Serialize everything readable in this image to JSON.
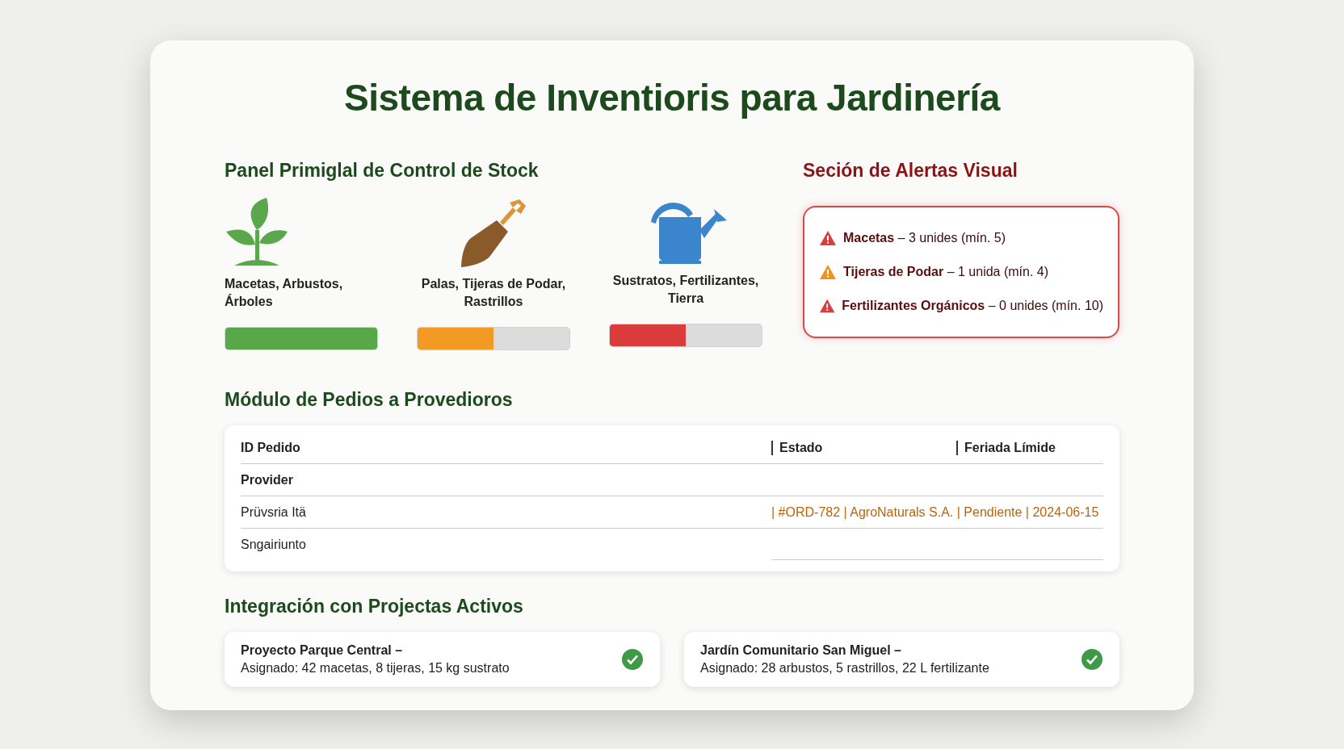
{
  "title": "Sistema de Inventioris para Jardinería",
  "stock": {
    "heading": "Panel Primiglal de Control de Stock",
    "categories": [
      {
        "kind": "plant",
        "label": "Macetas, Arbustos, Árboles",
        "level": 1,
        "color": "#58a84a"
      },
      {
        "kind": "shovel",
        "label": "Palas, Tijeras de Podar, Rastrillos",
        "level": 0.5,
        "color": "#f39a24"
      },
      {
        "kind": "watering-can",
        "label": "Sustratos, Fertilizantes, Tierra",
        "level": 0.5,
        "color": "#dc3b3b"
      }
    ]
  },
  "alerts": {
    "heading": "Seción de Alertas Visual",
    "items": [
      {
        "name": "Macetas",
        "detail": "– 3 unides (mín. 5)",
        "color": "#d64040"
      },
      {
        "name": "Tijeras de Podar",
        "detail": "– 1 unida (mín. 4)",
        "color": "#f0921f"
      },
      {
        "name": "Fertilizantes Orgánicos",
        "detail": "– 0 unides (mín. 10)",
        "color": "#d64040"
      }
    ]
  },
  "orders": {
    "heading": "Módulo de Pedios a Provedioros",
    "columns": [
      "ID Pedido",
      "Estado",
      "Feriada Límide"
    ],
    "rows": [
      {
        "kind": "label",
        "cells": [
          "Provider"
        ]
      },
      {
        "kind": "order",
        "cells": [
          "Prüvsria Itä",
          "| #ORD-782 | AgroNaturals S.A.  | Pendiente | 2024-06-15"
        ]
      },
      {
        "kind": "plain",
        "cells": [
          "Sngairiunto"
        ]
      }
    ]
  },
  "projects": {
    "heading": "Integración con Projectas Activos",
    "items": [
      {
        "title": "Proyecto Parque Central –",
        "detail": "Asignado: 42 macetas, 8 tijeras, 15 kg sustrato",
        "done": true
      },
      {
        "title": "Jardín Comunitario San Miguel –",
        "detail": "Asignado: 28 arbustos, 5 rastrillos, 22 L fertilizante",
        "done": true
      }
    ]
  }
}
